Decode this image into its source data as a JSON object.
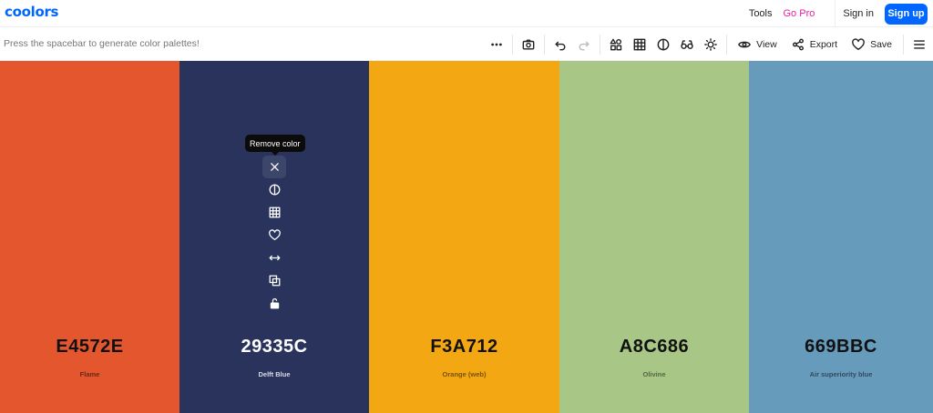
{
  "navbar": {
    "logo": "coolors",
    "tools": "Tools",
    "go_pro": "Go Pro",
    "sign_in": "Sign in",
    "sign_up": "Sign up"
  },
  "toolbar": {
    "hint": "Press the spacebar to generate color palettes!",
    "view": "View",
    "export": "Export",
    "save": "Save",
    "icons": [
      "more-icon",
      "camera-icon",
      "undo-icon",
      "redo-icon",
      "shapes-icon",
      "grid-icon",
      "contrast-icon",
      "glasses-icon",
      "sun-icon",
      "eye-icon",
      "share-icon",
      "heart-icon",
      "menu-icon"
    ]
  },
  "palette": [
    {
      "hex": "E4572E",
      "name": "Flame",
      "color": "#e4572e",
      "text_color": "#111111",
      "name_color": "#6b2613"
    },
    {
      "hex": "29335C",
      "name": "Delft Blue",
      "color": "#29335c",
      "text_color": "#ffffff",
      "name_color": "#d9dbe4"
    },
    {
      "hex": "F3A712",
      "name": "Orange (web)",
      "color": "#f3a712",
      "text_color": "#111111",
      "name_color": "#7a5308"
    },
    {
      "hex": "A8C686",
      "name": "Olivine",
      "color": "#a8c686",
      "text_color": "#111111",
      "name_color": "#566643"
    },
    {
      "hex": "669BBC",
      "name": "Air superiority blue",
      "color": "#669bbc",
      "text_color": "#111111",
      "name_color": "#2f4b5d"
    }
  ],
  "color_tools": {
    "tooltip": "Remove color",
    "icons": [
      "close-icon",
      "contrast-icon",
      "grid-icon",
      "heart-icon",
      "arrows-horizontal-icon",
      "copy-icon",
      "unlock-icon"
    ]
  },
  "colors": {
    "brand": "#0066ff",
    "pro": "#e81ea1"
  }
}
